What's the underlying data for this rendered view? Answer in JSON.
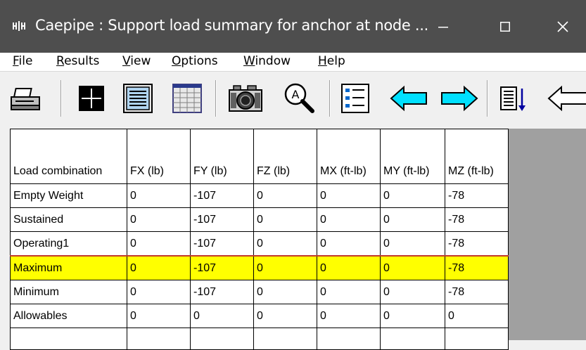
{
  "window": {
    "title": "Caepipe : Support load summary for anchor at node ...",
    "app_icon": "caepipe-icon",
    "minimize_icon": "minimize-icon",
    "maximize_icon": "maximize-icon",
    "close_icon": "close-icon"
  },
  "menu": {
    "items": [
      {
        "label": "File",
        "u": "F",
        "rest": "ile"
      },
      {
        "label": "Results",
        "u": "R",
        "rest": "esults"
      },
      {
        "label": "View",
        "u": "V",
        "rest": "iew"
      },
      {
        "label": "Options",
        "u": "O",
        "rest": "ptions"
      },
      {
        "label": "Window",
        "u": "W",
        "rest": "indow"
      },
      {
        "label": "Help",
        "u": "H",
        "rest": "elp"
      }
    ]
  },
  "toolbar": {
    "buttons": [
      "printer-icon",
      "crosshair-icon",
      "text-document-icon",
      "grid-icon",
      "camera-icon",
      "zoom-magnifier-icon",
      "list-icon",
      "arrow-left-icon",
      "arrow-right-icon",
      "sort-down-icon",
      "arrow-left-outline-icon"
    ]
  },
  "table": {
    "headers": [
      "Load combination",
      "FX (lb)",
      "FY (lb)",
      "FZ (lb)",
      "MX (ft-lb)",
      "MY (ft-lb)",
      "MZ (ft-lb)"
    ],
    "rows": [
      [
        "Empty Weight",
        "0",
        "-107",
        "0",
        "0",
        "0",
        "-78"
      ],
      [
        "Sustained",
        "0",
        "-107",
        "0",
        "0",
        "0",
        "-78"
      ],
      [
        "Operating1",
        "0",
        "-107",
        "0",
        "0",
        "0",
        "-78"
      ],
      [
        "Maximum",
        "0",
        "-107",
        "0",
        "0",
        "0",
        "-78"
      ],
      [
        "Minimum",
        "0",
        "-107",
        "0",
        "0",
        "0",
        "-78"
      ],
      [
        "Allowables",
        "0",
        "0",
        "0",
        "0",
        "0",
        "0"
      ]
    ],
    "highlight_color": "#ffff00",
    "highlight_row": "Maximum"
  }
}
